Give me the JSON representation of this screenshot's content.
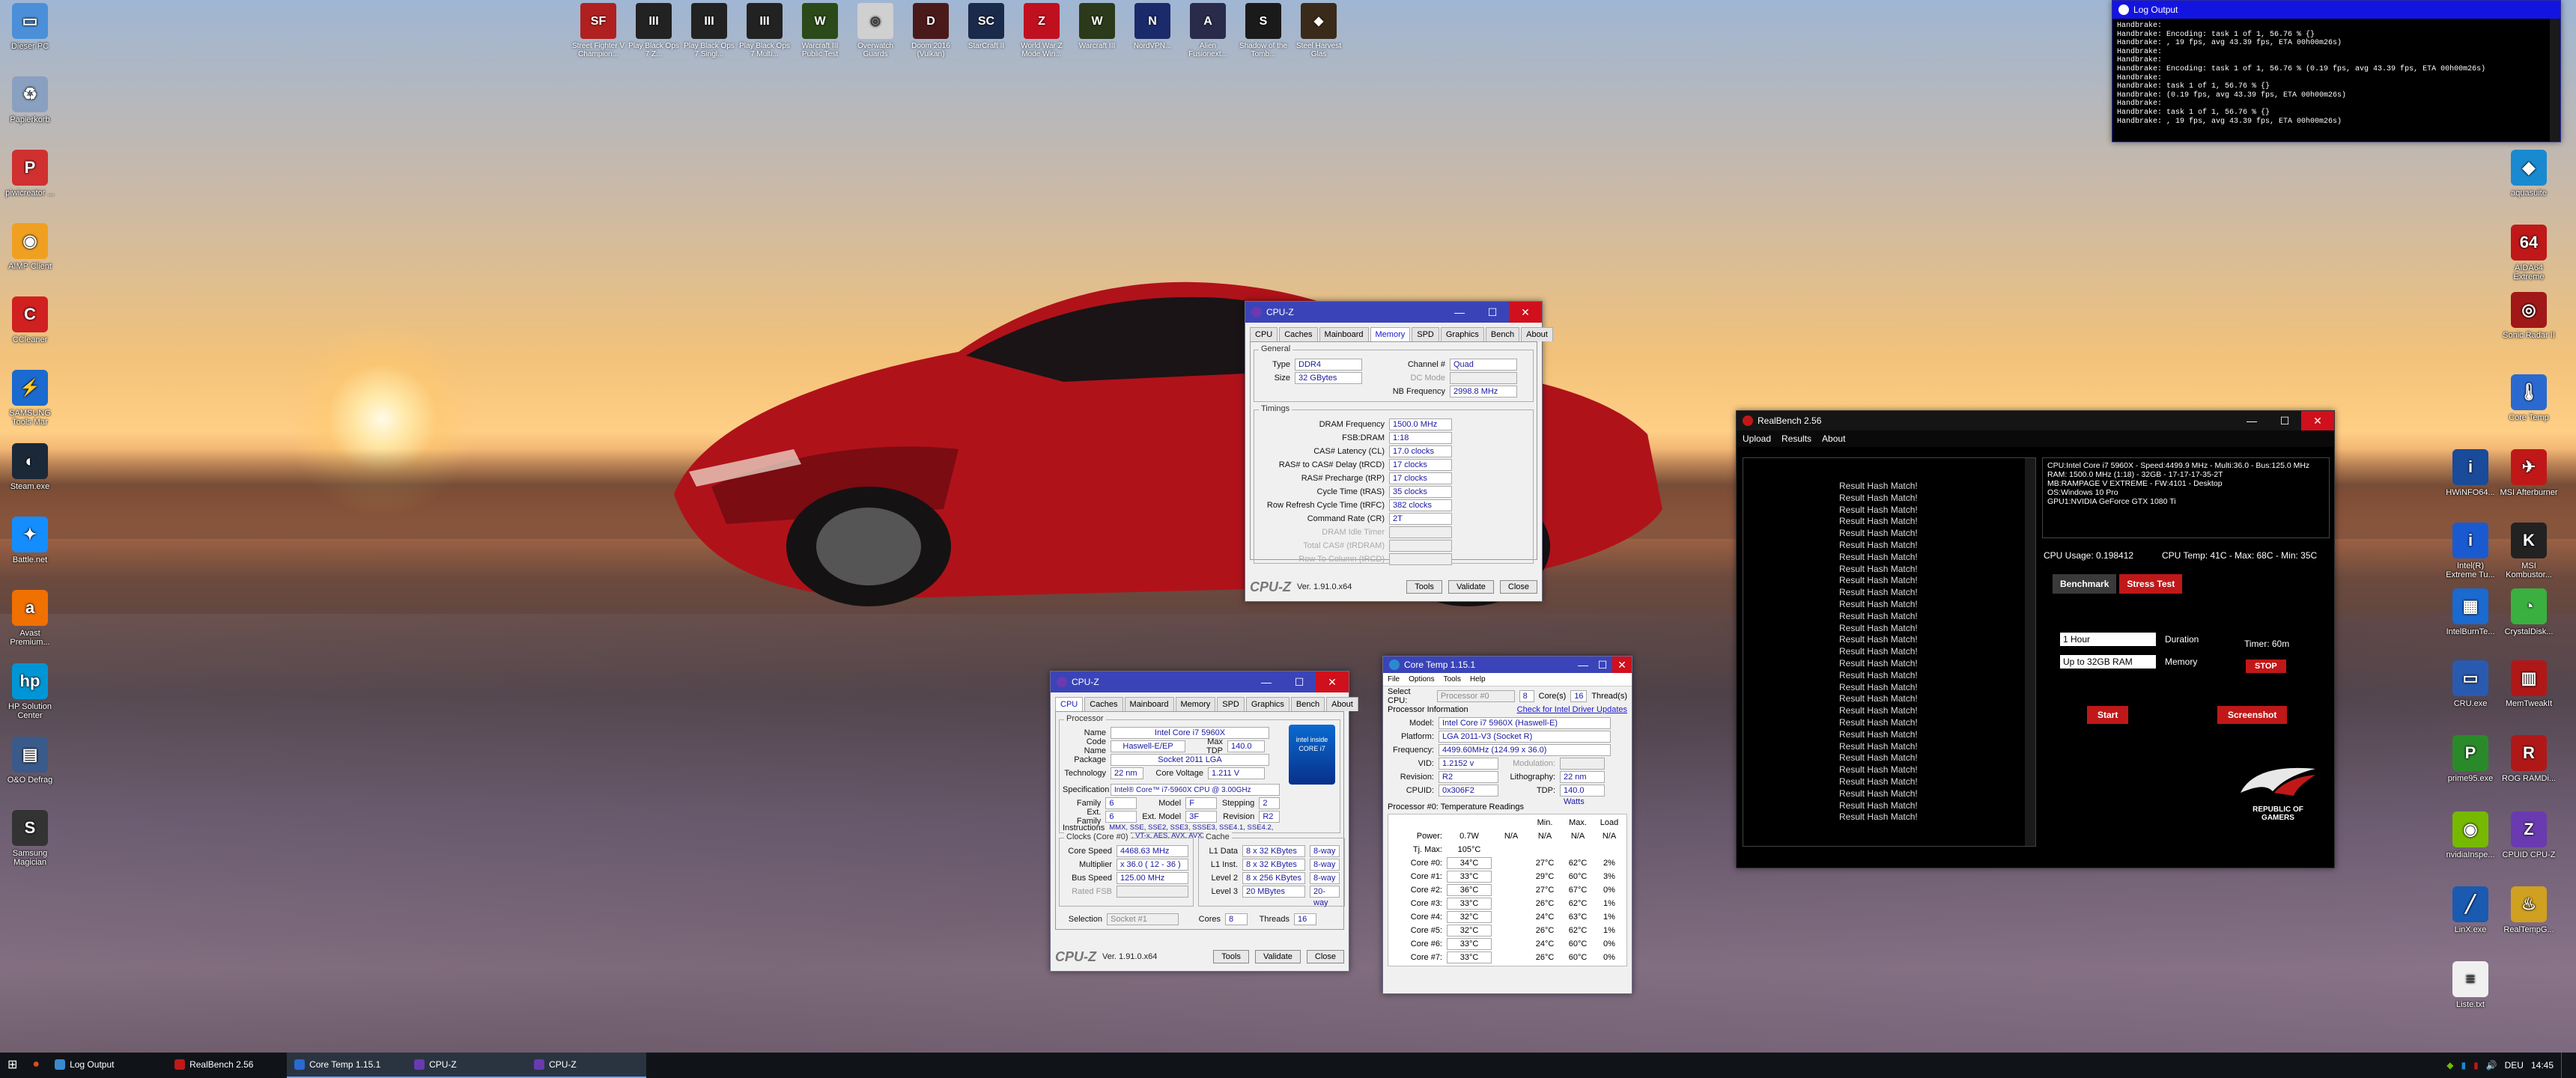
{
  "desktop_icons_left": [
    {
      "label": "Dieser PC",
      "icon": "computer-icon",
      "color": "#4a8fd8",
      "glyph": "▭"
    },
    {
      "label": "Papierkorb",
      "icon": "recycle-bin-icon",
      "color": "#8aa0c0",
      "glyph": "♻"
    },
    {
      "label": "piwicreator ...",
      "icon": "app-icon",
      "color": "#d03030",
      "glyph": "P"
    },
    {
      "label": "AIMP Client",
      "icon": "aimp-icon",
      "color": "#f0a020",
      "glyph": "◉"
    },
    {
      "label": "CCleaner",
      "icon": "ccleaner-icon",
      "color": "#d02020",
      "glyph": "C"
    },
    {
      "label": "SAMSUNG Tools Mar",
      "icon": "samsung-icon",
      "color": "#1a6ad0",
      "glyph": "⚡"
    },
    {
      "label": "Steam.exe",
      "icon": "steam-icon",
      "color": "#1b2838",
      "glyph": "◐"
    },
    {
      "label": "Battle.net",
      "icon": "battlenet-icon",
      "color": "#148eff",
      "glyph": "✦"
    },
    {
      "label": "Avast Premium...",
      "icon": "avast-icon",
      "color": "#f07000",
      "glyph": "a"
    },
    {
      "label": "HP Solution Center",
      "icon": "hp-icon",
      "color": "#0096d6",
      "glyph": "hp"
    },
    {
      "label": "O&O Defrag",
      "icon": "defrag-icon",
      "color": "#3a5a8a",
      "glyph": "▤"
    },
    {
      "label": "Samsung Magician",
      "icon": "magician-icon",
      "color": "#333",
      "glyph": "S"
    }
  ],
  "desktop_icons_top": [
    {
      "label": "Street Fighter V Champion...",
      "color": "#b02020",
      "glyph": "SF"
    },
    {
      "label": "Play Black Ops 7 Z...",
      "color": "#222",
      "glyph": "III"
    },
    {
      "label": "Play Black Ops 7 Singl...",
      "color": "#222",
      "glyph": "III"
    },
    {
      "label": "Play Black Ops 7 Multi...",
      "color": "#222",
      "glyph": "III"
    },
    {
      "label": "Warcraft III Public Test",
      "color": "#2a4a1a",
      "glyph": "W"
    },
    {
      "label": "Overwatch Guards",
      "color": "#d0d0d0",
      "glyph": "◎"
    },
    {
      "label": "Doom 2016 (Vulkan)",
      "color": "#4a1a1a",
      "glyph": "D"
    },
    {
      "label": "StarCraft II",
      "color": "#1a2a4a",
      "glyph": "SC"
    },
    {
      "label": "World War Z Mode Win...",
      "color": "#c01020",
      "glyph": "Z"
    },
    {
      "label": "Warcraft III",
      "color": "#2a3a1a",
      "glyph": "W"
    },
    {
      "label": "NordVPN...",
      "color": "#1a2a6a",
      "glyph": "N"
    },
    {
      "label": "Alien Fusionext...",
      "color": "#2a2a4a",
      "glyph": "A"
    },
    {
      "label": "Shadow of the Tomb...",
      "color": "#1a1a1a",
      "glyph": "S"
    },
    {
      "label": "Steel Harvest Glas",
      "color": "#3a2a1a",
      "glyph": "◆"
    }
  ],
  "desktop_icons_right": [
    {
      "label": "aquasuite",
      "color": "#1a8ad0",
      "glyph": "◆"
    },
    {
      "label": "AIDA64 Extreme",
      "color": "#c01818",
      "glyph": "64"
    },
    {
      "label": "Sonic Radar II",
      "color": "#a01818",
      "glyph": "◎"
    },
    {
      "label": "Core Temp",
      "color": "#2a6ad0",
      "glyph": "🌡"
    },
    {
      "label": "HWiNFO64...",
      "color": "#1a4a9a",
      "glyph": "i"
    },
    {
      "label": "MSI Afterburner",
      "color": "#c01818",
      "glyph": "✈"
    },
    {
      "label": "Intel(R) Extreme Tu...",
      "color": "#1a5ad0",
      "glyph": "i"
    },
    {
      "label": "MSI Kombustor...",
      "color": "#222",
      "glyph": "K"
    },
    {
      "label": "IntelBurnTe...",
      "color": "#1a6ad0",
      "glyph": "▦"
    },
    {
      "label": "CrystalDisk...",
      "color": "#3ab040",
      "glyph": "◔"
    },
    {
      "label": "CRU.exe",
      "color": "#2a5ab0",
      "glyph": "▭"
    },
    {
      "label": "MemTweakIt",
      "color": "#b01818",
      "glyph": "▥"
    },
    {
      "label": "prime95.exe",
      "color": "#2a8a2a",
      "glyph": "P"
    },
    {
      "label": "ROG RAMDi...",
      "color": "#b01818",
      "glyph": "R"
    },
    {
      "label": "nvidiaInspe...",
      "color": "#76b900",
      "glyph": "◉"
    },
    {
      "label": "CPUID CPU-Z",
      "color": "#6a3ab0",
      "glyph": "Z"
    },
    {
      "label": "LinX.exe",
      "color": "#1a5ab0",
      "glyph": "╱"
    },
    {
      "label": "RealTempG...",
      "color": "#d0a020",
      "glyph": "♨"
    },
    {
      "label": "Liste.txt",
      "color": "#f0f0f0",
      "glyph": "≡"
    }
  ],
  "log_output": {
    "title": "Log Output",
    "lines": [
      "Handbrake:",
      "Handbrake: Encoding: task 1 of 1, 56.76 % {}",
      "Handbrake: , 19 fps, avg 43.39 fps, ETA 00h00m26s)",
      "Handbrake:",
      "Handbrake:",
      "Handbrake: Encoding: task 1 of 1, 56.76 % (0.19 fps, avg 43.39 fps, ETA 00h00m26s)",
      "Handbrake:",
      "Handbrake: task 1 of 1, 56.76 % {}",
      "Handbrake: (0.19 fps, avg 43.39 fps, ETA 00h00m26s)",
      "Handbrake:",
      "Handbrake: task 1 of 1, 56.76 % {}",
      "Handbrake: , 19 fps, avg 43.39 fps, ETA 00h00m26s)"
    ]
  },
  "cpuz_mem": {
    "title": "CPU-Z",
    "tabs": [
      "CPU",
      "Caches",
      "Mainboard",
      "Memory",
      "SPD",
      "Graphics",
      "Bench",
      "About"
    ],
    "general_title": "General",
    "type_label": "Type",
    "type_value": "DDR4",
    "size_label": "Size",
    "size_value": "32 GBytes",
    "channel_label": "Channel #",
    "channel_value": "Quad",
    "dcmode_label": "DC Mode",
    "nb_label": "NB Frequency",
    "nb_value": "2998.8 MHz",
    "timings_title": "Timings",
    "timings": [
      {
        "label": "DRAM Frequency",
        "value": "1500.0 MHz"
      },
      {
        "label": "FSB:DRAM",
        "value": "1:18"
      },
      {
        "label": "CAS# Latency (CL)",
        "value": "17.0 clocks"
      },
      {
        "label": "RAS# to CAS# Delay (tRCD)",
        "value": "17 clocks"
      },
      {
        "label": "RAS# Precharge (tRP)",
        "value": "17 clocks"
      },
      {
        "label": "Cycle Time (tRAS)",
        "value": "35 clocks"
      },
      {
        "label": "Row Refresh Cycle Time (tRFC)",
        "value": "382 clocks"
      },
      {
        "label": "Command Rate (CR)",
        "value": "2T"
      },
      {
        "label": "DRAM Idle Timer",
        "value": ""
      },
      {
        "label": "Total CAS# (tRDRAM)",
        "value": ""
      },
      {
        "label": "Row To Column (tRCD)",
        "value": ""
      }
    ],
    "brand": "CPU-Z",
    "version": "Ver. 1.91.0.x64",
    "tools": "Tools",
    "validate": "Validate",
    "close": "Close"
  },
  "cpuz_cpu": {
    "title": "CPU-Z",
    "tabs": [
      "CPU",
      "Caches",
      "Mainboard",
      "Memory",
      "SPD",
      "Graphics",
      "Bench",
      "About"
    ],
    "processor_title": "Processor",
    "name_label": "Name",
    "name_value": "Intel Core i7 5960X",
    "codename_label": "Code Name",
    "codename_value": "Haswell-E/EP",
    "maxtdp_label": "Max TDP",
    "maxtdp_value": "140.0 W",
    "package_label": "Package",
    "package_value": "Socket 2011 LGA",
    "tech_label": "Technology",
    "tech_value": "22 nm",
    "voltage_label": "Core Voltage",
    "voltage_value": "1.211 V",
    "spec_label": "Specification",
    "spec_value": "Intel® Core™ i7-5960X CPU @ 3.00GHz",
    "family_label": "Family",
    "family_value": "6",
    "model_label": "Model",
    "model_value": "F",
    "stepping_label": "Stepping",
    "stepping_value": "2",
    "extfamily_label": "Ext. Family",
    "extfamily_value": "6",
    "extmodel_label": "Ext. Model",
    "extmodel_value": "3F",
    "revision_label": "Revision",
    "revision_value": "R2",
    "instr_label": "Instructions",
    "instr_value": "MMX, SSE, SSE2, SSE3, SSSE3, SSE4.1, SSE4.2, EM64T, VT-x, AES, AVX, AVX2, FMA3",
    "clocks_title": "Clocks (Core #0)",
    "corespeed_label": "Core Speed",
    "corespeed_value": "4468.63 MHz",
    "multiplier_label": "Multiplier",
    "multiplier_value": "x 36.0 ( 12 - 36 )",
    "busspeed_label": "Bus Speed",
    "busspeed_value": "125.00 MHz",
    "ratedfsb_label": "Rated FSB",
    "cache_title": "Cache",
    "cache": [
      {
        "label": "L1 Data",
        "value": "8 x 32 KBytes",
        "way": "8-way"
      },
      {
        "label": "L1 Inst.",
        "value": "8 x 32 KBytes",
        "way": "8-way"
      },
      {
        "label": "Level 2",
        "value": "8 x 256 KBytes",
        "way": "8-way"
      },
      {
        "label": "Level 3",
        "value": "20 MBytes",
        "way": "20-way"
      }
    ],
    "selection_label": "Selection",
    "selection_value": "Socket #1",
    "cores_label": "Cores",
    "cores_value": "8",
    "threads_label": "Threads",
    "threads_value": "16",
    "intel_logo": "intel inside CORE i7",
    "brand": "CPU-Z",
    "version": "Ver. 1.91.0.x64",
    "tools": "Tools",
    "validate": "Validate",
    "close": "Close"
  },
  "coretemp": {
    "title": "Core Temp 1.15.1",
    "menu": [
      "File",
      "Options",
      "Tools",
      "Help"
    ],
    "select_cpu_label": "Select CPU:",
    "select_cpu_value": "Processor #0",
    "cores_value": "8",
    "cores_label": "Core(s)",
    "threads_value": "16",
    "threads_label": "Thread(s)",
    "info_title": "Processor Information",
    "driver_link": "Check for Intel Driver Updates",
    "info": [
      {
        "label": "Model:",
        "value": "Intel Core i7 5960X (Haswell-E)"
      },
      {
        "label": "Platform:",
        "value": "LGA 2011-V3 (Socket R)"
      },
      {
        "label": "Frequency:",
        "value": "4499.60MHz (124.99 x 36.0)"
      },
      {
        "label": "VID:",
        "value": "1.2152 v"
      },
      {
        "label": "Revision:",
        "value": "R2"
      },
      {
        "label": "CPUID:",
        "value": "0x306F2"
      }
    ],
    "modulation_label": "Modulation:",
    "lithography_label": "Lithography:",
    "lithography_value": "22 nm",
    "tdp_label": "TDP:",
    "tdp_value": "140.0 Watts",
    "readings_title": "Processor #0: Temperature Readings",
    "headers": [
      "",
      "",
      "",
      "Min.",
      "Max.",
      "Load"
    ],
    "power_row": {
      "label": "Power:",
      "c1": "0.7W",
      "c2": "N/A",
      "c3": "N/A",
      "c4": "N/A",
      "c5": "N/A"
    },
    "tjmax_row": {
      "label": "Tj. Max:",
      "value": "105°C"
    },
    "cores": [
      {
        "name": "Core #0:",
        "temp": "34°C",
        "min": "27°C",
        "max": "62°C",
        "load": "2%"
      },
      {
        "name": "Core #1:",
        "temp": "33°C",
        "min": "29°C",
        "max": "60°C",
        "load": "3%"
      },
      {
        "name": "Core #2:",
        "temp": "36°C",
        "min": "27°C",
        "max": "67°C",
        "load": "0%"
      },
      {
        "name": "Core #3:",
        "temp": "33°C",
        "min": "26°C",
        "max": "62°C",
        "load": "1%"
      },
      {
        "name": "Core #4:",
        "temp": "32°C",
        "min": "24°C",
        "max": "63°C",
        "load": "1%"
      },
      {
        "name": "Core #5:",
        "temp": "32°C",
        "min": "26°C",
        "max": "62°C",
        "load": "1%"
      },
      {
        "name": "Core #6:",
        "temp": "33°C",
        "min": "24°C",
        "max": "60°C",
        "load": "0%"
      },
      {
        "name": "Core #7:",
        "temp": "33°C",
        "min": "26°C",
        "max": "60°C",
        "load": "0%"
      }
    ]
  },
  "realbench": {
    "title": "RealBench 2.56",
    "menu": [
      "Upload",
      "Results",
      "About"
    ],
    "hash_line": "Result Hash Match!",
    "hash_count": 29,
    "sysinfo": [
      "CPU:Intel Core i7 5960X - Speed:4499.9 MHz - Multi:36.0 - Bus:125.0 MHz",
      "RAM: 1500.0 MHz (1:18) - 32GB - 17-17-17-35-2T",
      "MB:RAMPAGE V EXTREME - FW:4101 - Desktop",
      "OS:Windows 10 Pro",
      "GPU1:NVIDIA GeForce GTX 1080 Ti"
    ],
    "cpu_usage": "CPU Usage: 0.198412",
    "cpu_temp": "CPU Temp:  41C - Max:  68C - Min:  35C",
    "benchmark": "Benchmark",
    "stress_test": "Stress Test",
    "duration_value": "1 Hour",
    "duration_label": "Duration",
    "memory_value": "Up to 32GB RAM",
    "memory_label": "Memory",
    "timer": "Timer: 60m",
    "stop": "STOP",
    "start": "Start",
    "screenshot": "Screenshot",
    "rog_logo": "REPUBLIC OF GAMERS"
  },
  "taskbar": {
    "items": [
      {
        "label": "Log Output",
        "color": "#3a8ad0"
      },
      {
        "label": "RealBench 2.56",
        "color": "#c01818"
      },
      {
        "label": "Core Temp 1.15.1",
        "color": "#2a6ad0"
      },
      {
        "label": "CPU-Z",
        "color": "#6a3ab0"
      },
      {
        "label": "CPU-Z",
        "color": "#6a3ab0"
      }
    ],
    "lang": "DEU",
    "time": "14:45"
  }
}
